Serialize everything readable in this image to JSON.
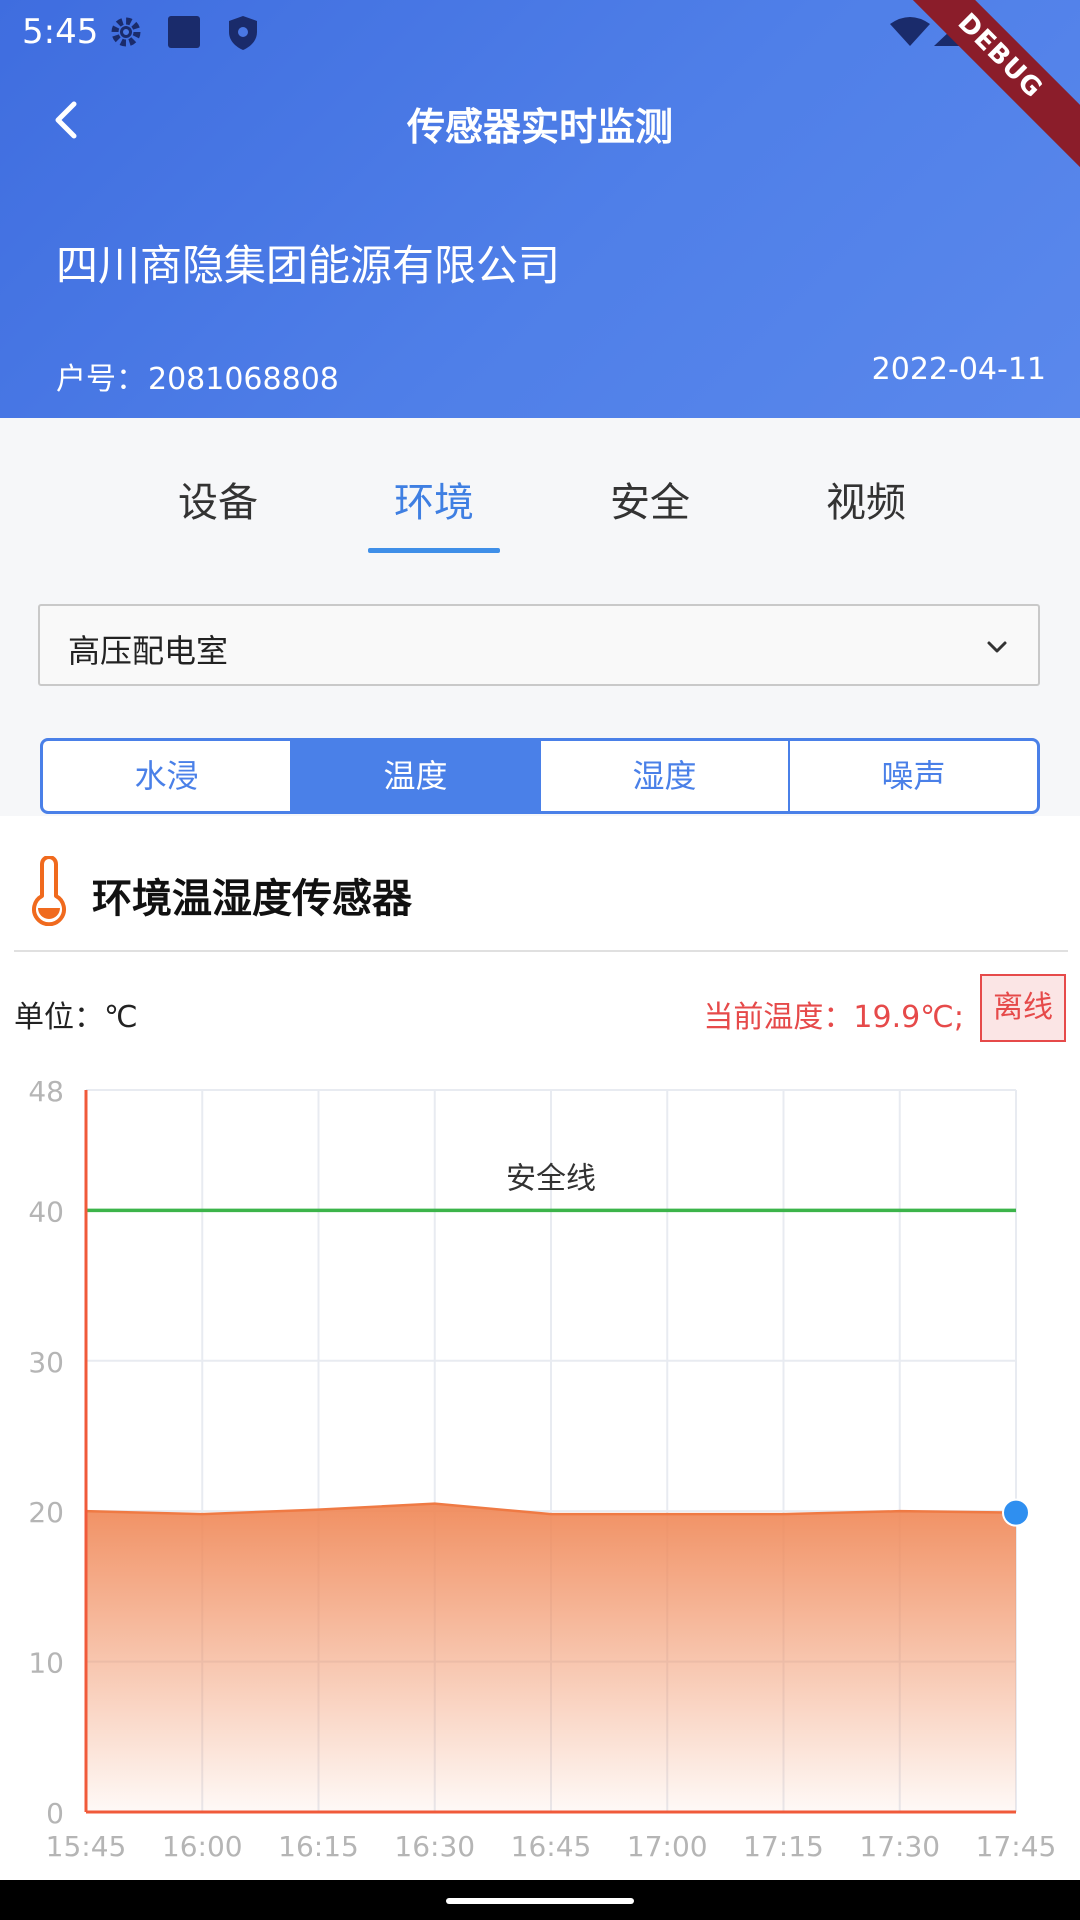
{
  "status_bar": {
    "time": "5:45",
    "debug_label": "DEBUG"
  },
  "header": {
    "title": "传感器实时监测",
    "company": "四川商隐集团能源有限公司",
    "account_label": "户号：",
    "account_number": "2081068808",
    "date": "2022-04-11"
  },
  "tabs": [
    {
      "label": "设备"
    },
    {
      "label": "环境"
    },
    {
      "label": "安全"
    },
    {
      "label": "视频"
    }
  ],
  "active_tab": "环境",
  "location_select": {
    "value": "高压配电室"
  },
  "sensor_types": [
    {
      "label": "水浸"
    },
    {
      "label": "温度"
    },
    {
      "label": "湿度"
    },
    {
      "label": "噪声"
    }
  ],
  "active_sensor_type": "温度",
  "sensor": {
    "title": "环境温湿度传感器",
    "unit_label": "单位：℃",
    "current_reading": "当前温度：19.9℃;",
    "status": "离线"
  },
  "colors": {
    "primary": "#4a80e8",
    "accent_orange": "#f08050",
    "safety_line": "#3cb44a",
    "alert_red": "#e64a4a"
  },
  "chart_data": {
    "type": "area",
    "x": [
      "15:45",
      "16:00",
      "16:15",
      "16:30",
      "16:45",
      "17:00",
      "17:15",
      "17:30",
      "17:45"
    ],
    "series": [
      {
        "values": [
          20.0,
          19.8,
          20.1,
          20.5,
          19.8,
          19.8,
          19.8,
          20.0,
          19.9
        ]
      }
    ],
    "yticks": [
      0,
      10,
      20,
      30,
      40,
      48
    ],
    "ylim": [
      0,
      48
    ],
    "reference_line": {
      "label": "安全线",
      "value": 40
    },
    "grid": true
  }
}
